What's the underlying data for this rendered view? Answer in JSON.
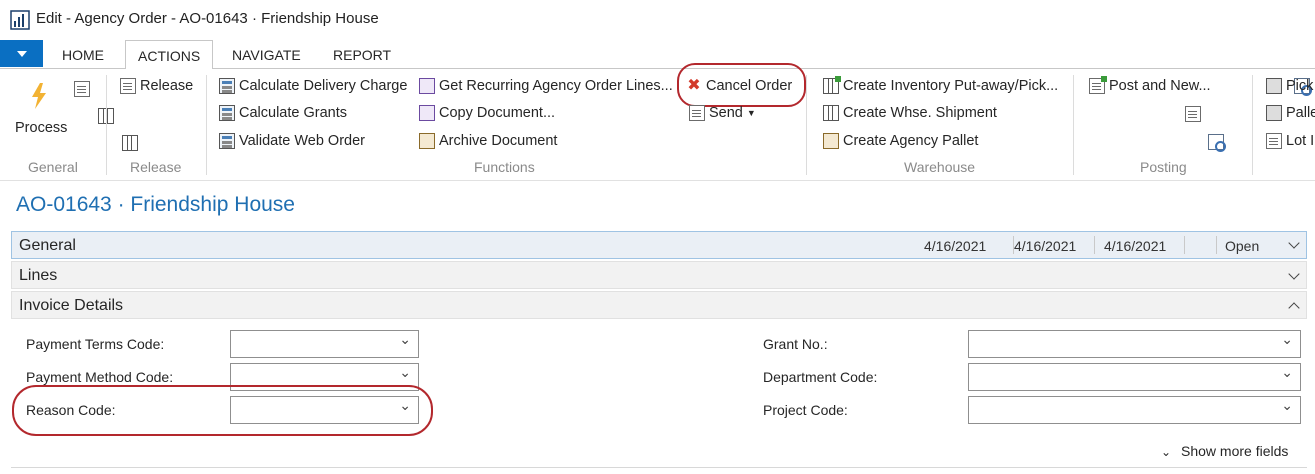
{
  "window": {
    "title": "Edit - Agency Order - AO-01643 · Friendship House"
  },
  "tabs": [
    "HOME",
    "ACTIONS",
    "NAVIGATE",
    "REPORT"
  ],
  "ribbon": {
    "general": {
      "process": "Process",
      "label": "General"
    },
    "release": {
      "release": "Release",
      "label": "Release"
    },
    "functions": {
      "calc_delivery": "Calculate Delivery Charge",
      "calc_grants": "Calculate Grants",
      "validate_web": "Validate Web Order",
      "get_recurring": "Get Recurring Agency Order Lines...",
      "copy_document": "Copy Document...",
      "archive_document": "Archive Document",
      "cancel_order": "Cancel Order",
      "send": "Send",
      "label": "Functions"
    },
    "warehouse": {
      "inv_putaway": "Create Inventory Put-away/Pick...",
      "whse_shipment": "Create Whse. Shipment",
      "agency_pallet": "Create Agency Pallet",
      "label": "Warehouse"
    },
    "posting": {
      "post_new": "Post and New...",
      "label": "Posting"
    },
    "more": {
      "pick": "Pick",
      "pallet": "Palle",
      "lot": "Lot I"
    }
  },
  "page": {
    "title": "AO-01643 · Friendship House",
    "general": {
      "label": "General",
      "date1": "4/16/2021",
      "date2": "4/16/2021",
      "date3": "4/16/2021",
      "status": "Open"
    },
    "lines": {
      "label": "Lines"
    },
    "invoice": {
      "label": "Invoice Details",
      "payment_terms": "Payment Terms Code:",
      "payment_method": "Payment Method Code:",
      "reason_code": "Reason Code:",
      "grant_no": "Grant No.:",
      "department_code": "Department Code:",
      "project_code": "Project Code:",
      "show_more": "Show more fields"
    }
  },
  "colors": {
    "accent": "#1f6fb2",
    "highlight_circle": "#b3282d",
    "menu_button": "#0a6fc2"
  }
}
